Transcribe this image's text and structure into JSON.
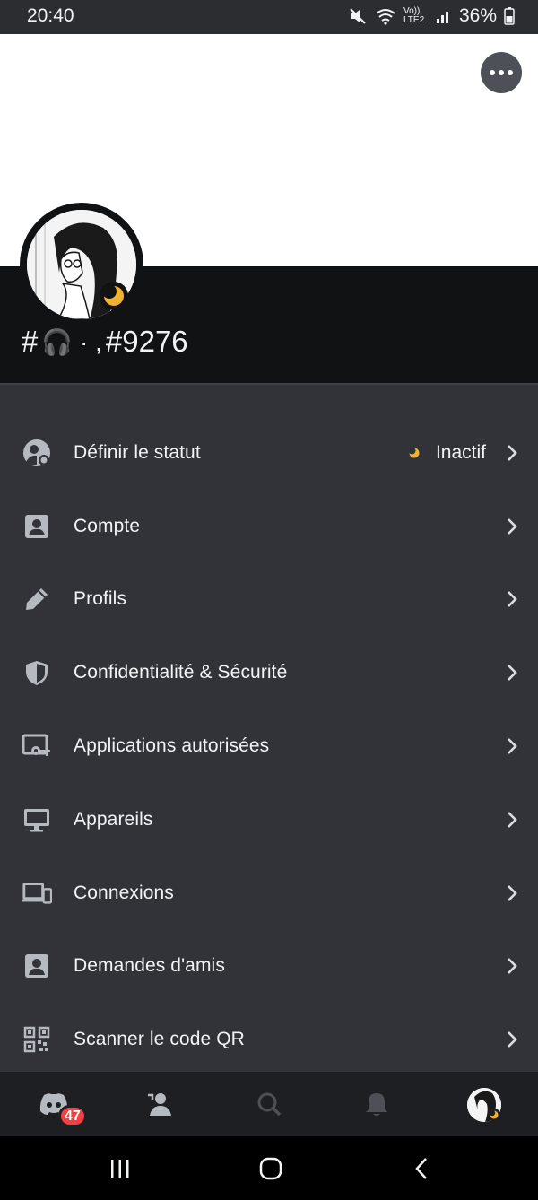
{
  "status_bar": {
    "time": "20:40",
    "network_label": "Vo)) LTE2",
    "battery_text": "36%",
    "icons": [
      "mute-icon",
      "wifi-icon",
      "signal-icon",
      "battery-icon"
    ]
  },
  "profile": {
    "username_prefix": "#",
    "username_emoji": "🎧 · ,",
    "discriminator": "#9276",
    "status": "idle"
  },
  "menu": {
    "items": [
      {
        "label": "Définir le statut",
        "icon": "status-person-icon",
        "value": "Inactif"
      },
      {
        "label": "Compte",
        "icon": "account-card-icon"
      },
      {
        "label": "Profils",
        "icon": "pencil-icon"
      },
      {
        "label": "Confidentialité & Sécurité",
        "icon": "shield-icon"
      },
      {
        "label": "Applications autorisées",
        "icon": "authorized-apps-icon"
      },
      {
        "label": "Appareils",
        "icon": "monitor-icon"
      },
      {
        "label": "Connexions",
        "icon": "devices-icon"
      },
      {
        "label": "Demandes d'amis",
        "icon": "friend-request-icon"
      },
      {
        "label": "Scanner le code QR",
        "icon": "qr-code-icon"
      }
    ]
  },
  "bottom_nav": {
    "badge_count": "47",
    "items": [
      "home-icon",
      "friends-icon",
      "search-icon",
      "notifications-icon",
      "profile-avatar"
    ]
  },
  "colors": {
    "background": "#313338",
    "header": "#111214",
    "nav": "#1e1f22",
    "idle": "#f0b232",
    "badge": "#f23f43"
  }
}
